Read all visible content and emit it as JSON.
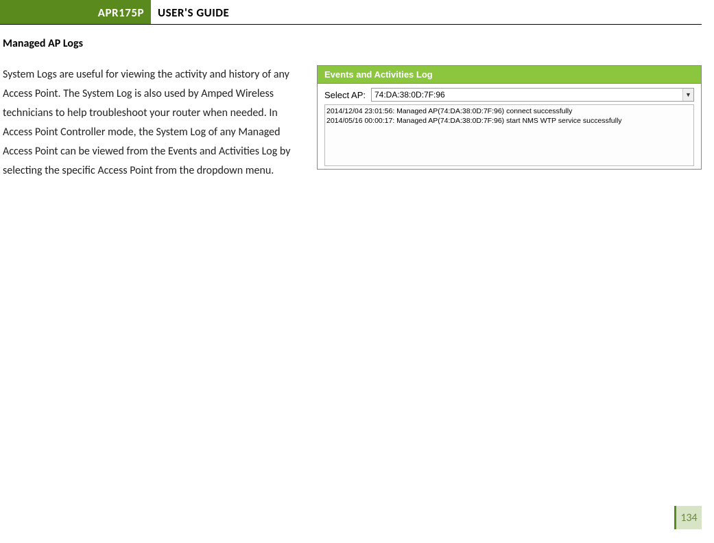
{
  "header": {
    "badge": "APR175P",
    "title": "USER'S GUIDE"
  },
  "section": {
    "title": "Managed AP Logs",
    "body": "System Logs are useful for viewing the activity and history of any Access Point. The System Log is also used by Amped Wireless technicians to help troubleshoot your router when needed.  In Access Point Controller mode, the System Log of any Managed Access Point can be viewed from the Events and Activities Log by selecting the specific Access Point from the dropdown menu."
  },
  "figure": {
    "panel_title": "Events and Activities Log",
    "select_label": "Select AP:",
    "selected_ap": "74:DA:38:0D:7F:96",
    "log_lines": [
      "2014/12/04 23:01:56: Managed AP(74:DA:38:0D:7F:96) connect successfully",
      "2014/05/16 00:00:17: Managed AP(74:DA:38:0D:7F:96) start NMS WTP service successfully"
    ]
  },
  "page_number": "134"
}
